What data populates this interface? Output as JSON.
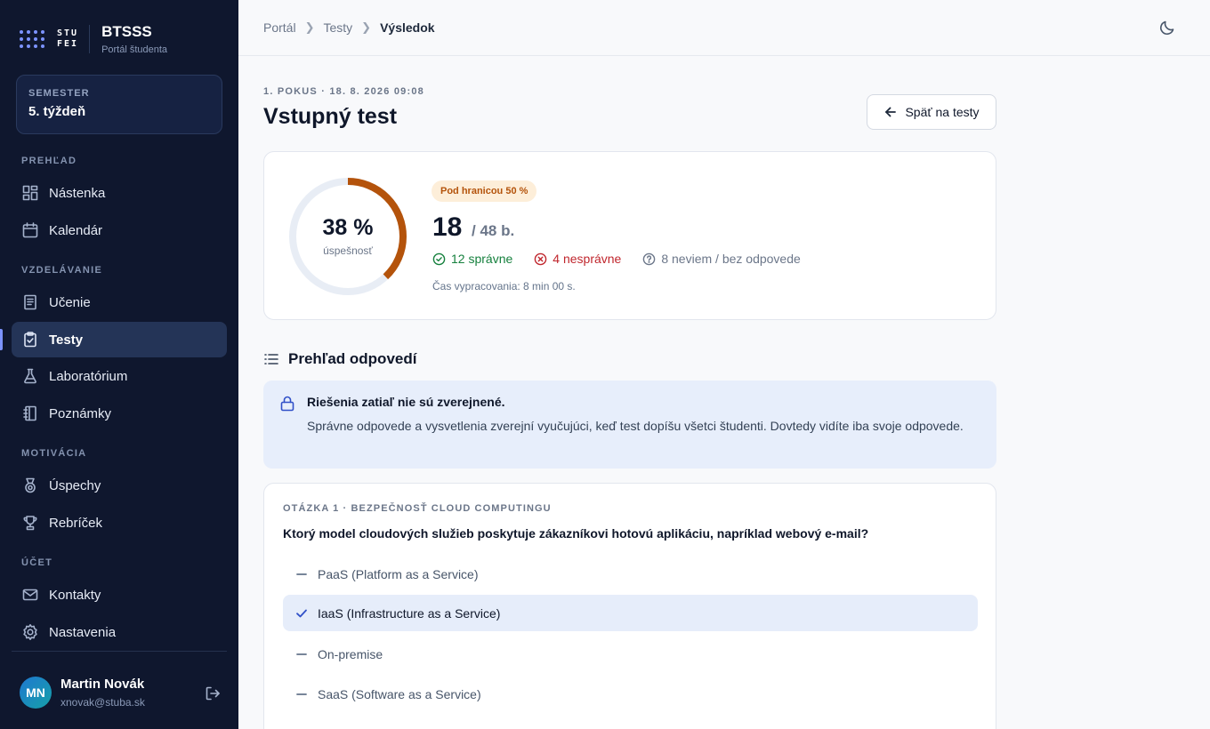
{
  "brand": {
    "mark_line1": "STU",
    "mark_line2": "FEI",
    "name": "BTSSS",
    "subtitle": "Portál študenta"
  },
  "semester": {
    "label": "SEMESTER",
    "value": "5. týždeň"
  },
  "nav": {
    "sections": {
      "overview": "PREHĽAD",
      "education": "VZDELÁVANIE",
      "motivation": "MOTIVÁCIA",
      "account": "ÚČET"
    },
    "items": [
      {
        "label": "Nástenka",
        "icon": "dashboard-icon"
      },
      {
        "label": "Kalendár",
        "icon": "calendar-icon"
      },
      {
        "label": "Učenie",
        "icon": "book-icon"
      },
      {
        "label": "Testy",
        "icon": "clipboard-check-icon",
        "active": true
      },
      {
        "label": "Laboratórium",
        "icon": "flask-icon"
      },
      {
        "label": "Poznámky",
        "icon": "notebook-icon"
      },
      {
        "label": "Úspechy",
        "icon": "medal-icon"
      },
      {
        "label": "Rebríček",
        "icon": "trophy-icon"
      },
      {
        "label": "Kontakty",
        "icon": "mail-icon"
      },
      {
        "label": "Nastavenia",
        "icon": "gear-icon"
      }
    ]
  },
  "user": {
    "initials": "MN",
    "name": "Martin Novák",
    "email": "xnovak@stuba.sk"
  },
  "breadcrumb": {
    "items": [
      "Portál",
      "Testy"
    ],
    "current": "Výsledok"
  },
  "header": {
    "eyebrow": "1. POKUS · 18. 8. 2026 09:08",
    "title": "Vstupný test",
    "back_label": "Späť na testy"
  },
  "result": {
    "percent_label": "38 %",
    "percent_value": 38,
    "percent_caption": "úspešnosť",
    "badge": "Pod hranicou 50 %",
    "score": "18",
    "total": "/ 48 b.",
    "correct": "12 správne",
    "wrong": "4 nesprávne",
    "skipped": "8 neviem / bez odpovede",
    "duration": "Čas vypracovania: 8 min 00 s."
  },
  "answers": {
    "title": "Prehľad odpovedí",
    "notice_title": "Riešenia zatiaľ nie sú zverejnené.",
    "notice_body": "Správne odpovede a vysvetlenia zverejní vyučujúci, keď test dopíšu všetci študenti. Dovtedy vidíte iba svoje odpovede."
  },
  "question": {
    "meta": "OTÁZKA 1 · BEZPEČNOSŤ CLOUD COMPUTINGU",
    "text": "Ktorý model cloudových služieb poskytuje zákazníkovi hotovú aplikáciu, napríklad webový e-mail?",
    "options": [
      {
        "label": "PaaS (Platform as a Service)",
        "selected": false
      },
      {
        "label": "IaaS (Infrastructure as a Service)",
        "selected": true
      },
      {
        "label": "On-premise",
        "selected": false
      },
      {
        "label": "SaaS (Software as a Service)",
        "selected": false
      }
    ]
  },
  "colors": {
    "sidebar_bg": "#0f172e",
    "accent": "#7c93ff",
    "ring_progress": "#b4530b",
    "ring_track": "#e8edf5",
    "correct": "#15803d",
    "wrong": "#c0262d"
  }
}
